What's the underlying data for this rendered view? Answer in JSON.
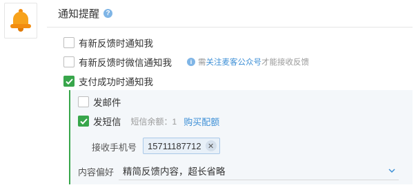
{
  "header": {
    "title": "通知提醒"
  },
  "options": [
    {
      "label": "有新反馈时通知我",
      "checked": false
    },
    {
      "label": "有新反馈时微信通知我",
      "checked": false
    },
    {
      "label": "支付成功时通知我",
      "checked": true
    }
  ],
  "wechat_hint": {
    "prefix": "需",
    "link": "关注麦客公众号",
    "suffix": "才能接收反馈"
  },
  "sub": {
    "email": {
      "label": "发邮件",
      "checked": false
    },
    "sms": {
      "label": "发短信",
      "checked": true,
      "balance": "短信余额：1",
      "buy": "购买配额"
    },
    "phone": {
      "label": "接收手机号",
      "value": "15711187712"
    },
    "preference": {
      "label": "内容偏好",
      "value": "精简反馈内容，超长省略"
    }
  },
  "colors": {
    "accent_green": "#38a64b",
    "link_blue": "#3d8fd6",
    "bell": "#f7a21b"
  },
  "icons": [
    "bell-icon",
    "help-icon",
    "info-icon",
    "check-icon",
    "close-icon",
    "chevron-down-icon"
  ]
}
